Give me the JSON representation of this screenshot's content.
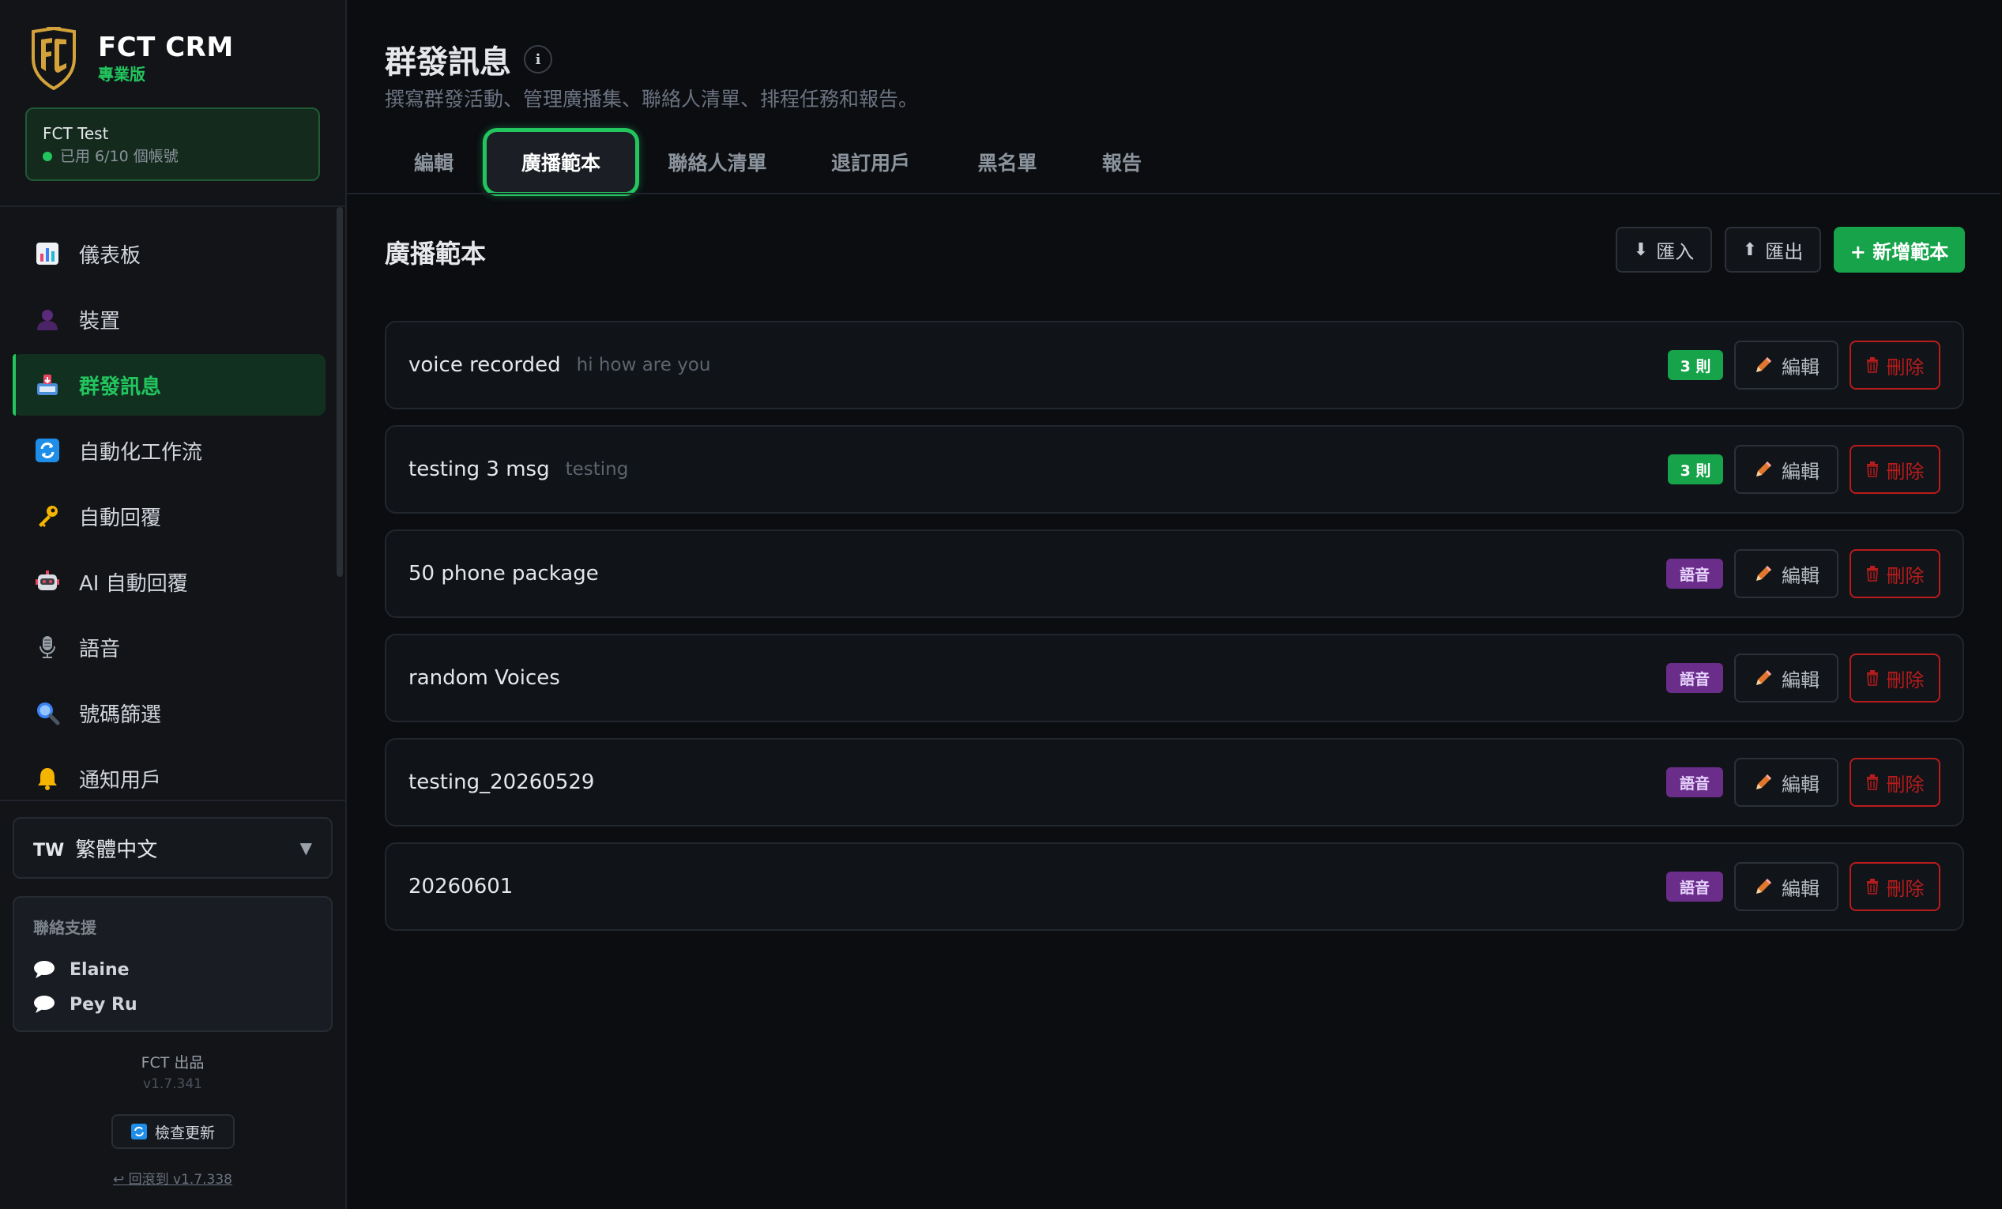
{
  "brand": {
    "title": "FCT CRM",
    "subtitle": "專業版"
  },
  "account": {
    "name": "FCT Test",
    "usage": "已用 6/10 個帳號"
  },
  "nav": [
    {
      "label": "儀表板",
      "icon": "bar-chart-icon",
      "active": false
    },
    {
      "label": "裝置",
      "icon": "user-icon",
      "active": false
    },
    {
      "label": "群發訊息",
      "icon": "inbox-tray-icon",
      "active": true
    },
    {
      "label": "自動化工作流",
      "icon": "refresh-icon",
      "active": false
    },
    {
      "label": "自動回覆",
      "icon": "key-icon",
      "active": false
    },
    {
      "label": "AI 自動回覆",
      "icon": "robot-icon",
      "active": false
    },
    {
      "label": "語音",
      "icon": "microphone-icon",
      "active": false
    },
    {
      "label": "號碼篩選",
      "icon": "magnifier-icon",
      "active": false
    },
    {
      "label": "通知用戶",
      "icon": "bell-icon",
      "active": false
    }
  ],
  "language": {
    "code": "TW",
    "label": "繁體中文"
  },
  "support": {
    "title": "聯絡支援",
    "contacts": [
      "Elaine",
      "Pey Ru"
    ]
  },
  "footer": {
    "brand": "FCT 出品",
    "version": "v1.7.341",
    "update_label": "檢查更新",
    "rollback_label": "↩ 回滾到 v1.7.338"
  },
  "page": {
    "title": "群發訊息",
    "info_glyph": "i",
    "subtitle": "撰寫群發活動、管理廣播集、聯絡人清單、排程任務和報告。"
  },
  "tabs": [
    {
      "label": "編輯",
      "active": false
    },
    {
      "label": "廣播範本",
      "active": true
    },
    {
      "label": "聯絡人清單",
      "active": false
    },
    {
      "label": "退訂用戶",
      "active": false
    },
    {
      "label": "黑名單",
      "active": false
    },
    {
      "label": "報告",
      "active": false
    }
  ],
  "section": {
    "title": "廣播範本",
    "import_label": "匯入",
    "export_label": "匯出",
    "add_label": "+ 新增範本"
  },
  "row_actions": {
    "edit_label": "編輯",
    "delete_label": "刪除"
  },
  "templates": [
    {
      "name": "voice recorded",
      "preview": "hi how are you",
      "badge": "3 則",
      "badge_type": "green"
    },
    {
      "name": "testing 3 msg",
      "preview": "testing",
      "badge": "3 則",
      "badge_type": "green"
    },
    {
      "name": "50 phone package",
      "preview": "",
      "badge": "語音",
      "badge_type": "purple"
    },
    {
      "name": "random Voices",
      "preview": "",
      "badge": "語音",
      "badge_type": "purple"
    },
    {
      "name": "testing_20260529",
      "preview": "",
      "badge": "語音",
      "badge_type": "purple"
    },
    {
      "name": "20260601",
      "preview": "",
      "badge": "語音",
      "badge_type": "purple"
    }
  ],
  "colors": {
    "accent": "#22c55e",
    "primary_button": "#16a34a",
    "danger": "#b91c1c",
    "voice_badge": "#6b2d8a",
    "background": "#0b0d11",
    "sidebar": "#121418"
  }
}
